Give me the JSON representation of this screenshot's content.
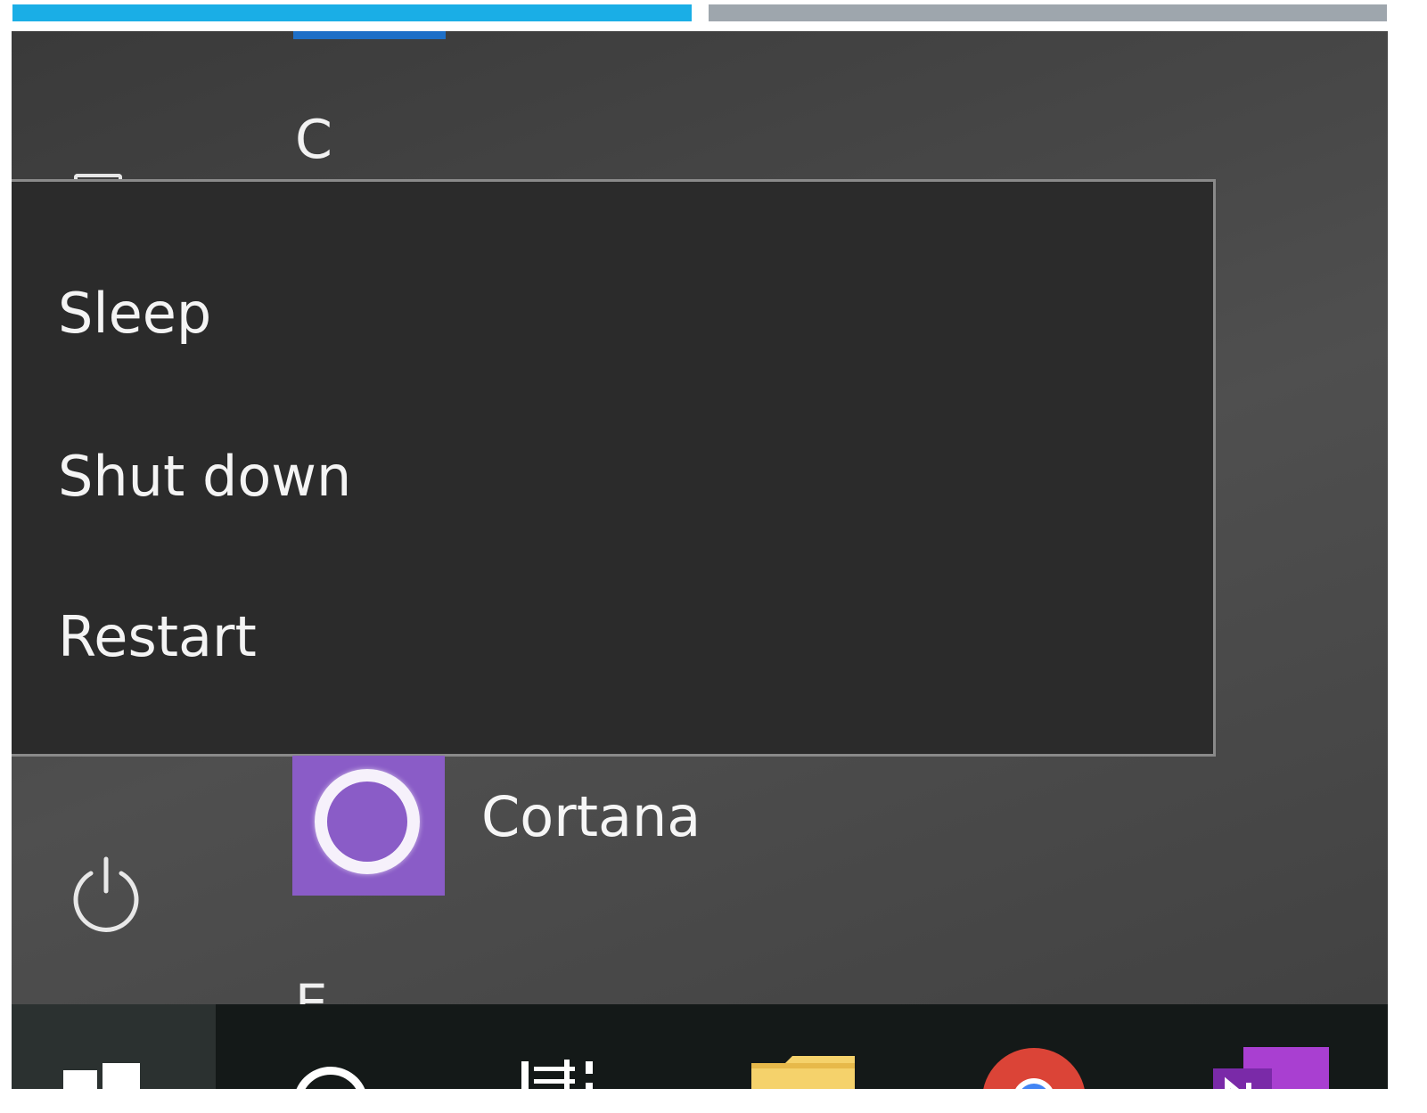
{
  "top_bars": {
    "left_color": "#1aaee6",
    "right_color": "#9ea6ad"
  },
  "app_list": {
    "group_letter_c": "C",
    "group_letter_e": "E",
    "cortana": {
      "label": "Cortana",
      "icon": "cortana-icon",
      "tile_color": "#8a5cc7"
    }
  },
  "power_menu": {
    "items": [
      {
        "label": "Sleep"
      },
      {
        "label": "Shut down"
      },
      {
        "label": "Restart"
      }
    ]
  },
  "sidebar": {
    "power_icon": "power-icon",
    "document_icon": "document-icon"
  },
  "taskbar": {
    "items": [
      {
        "icon": "windows-logo-icon"
      },
      {
        "icon": "search-icon"
      },
      {
        "icon": "task-view-icon"
      },
      {
        "icon": "file-explorer-icon"
      },
      {
        "icon": "chrome-icon"
      },
      {
        "icon": "onenote-icon"
      }
    ]
  }
}
